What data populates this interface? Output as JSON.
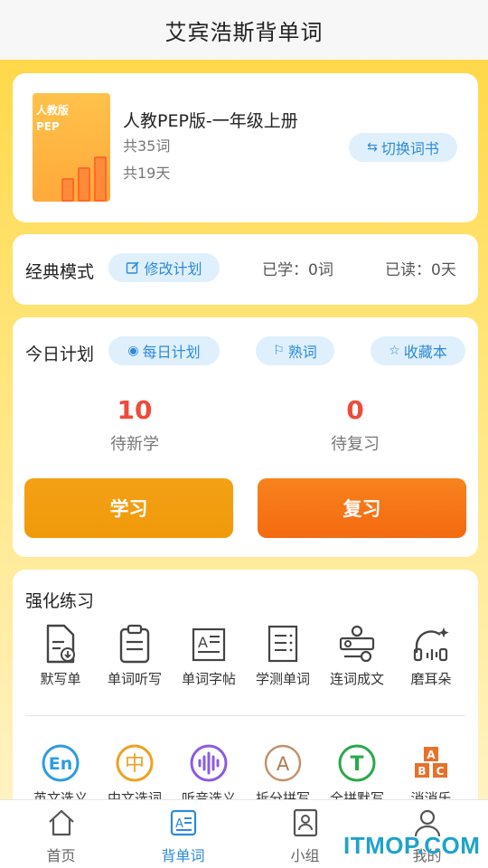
{
  "header": {
    "title": "艾宾浩斯背单词"
  },
  "book": {
    "cover_line1": "人教版",
    "cover_line2": "PEP",
    "title": "人教PEP版-一年级上册",
    "word_count": "共35词",
    "day_count": "共19天",
    "switch_label": "切换词书",
    "switch_icon": "swap-icon"
  },
  "mode": {
    "label": "经典模式",
    "edit_label": "修改计划",
    "learned": "已学：0词",
    "read": "已读：0天"
  },
  "plan": {
    "label": "今日计划",
    "daily_label": "每日计划",
    "familiar_label": "熟词",
    "favorites_label": "收藏本",
    "new_count": "10",
    "new_label": "待新学",
    "review_count": "0",
    "review_label": "待复习",
    "study_button": "学习",
    "review_button": "复习"
  },
  "practice": {
    "label": "强化练习",
    "row1": [
      {
        "label": "默写单",
        "icon": "document-download-icon"
      },
      {
        "label": "单词听写",
        "icon": "clipboard-icon"
      },
      {
        "label": "单词字帖",
        "icon": "copybook-icon"
      },
      {
        "label": "学测单词",
        "icon": "test-paper-icon"
      },
      {
        "label": "连词成文",
        "icon": "connect-words-icon"
      },
      {
        "label": "磨耳朵",
        "icon": "headphones-icon"
      }
    ],
    "row2": [
      {
        "label": "英文选义",
        "glyph": "En",
        "color": "#2d9ce0"
      },
      {
        "label": "中文选词",
        "glyph": "中",
        "color": "#f0a020"
      },
      {
        "label": "听音选义",
        "glyph": "",
        "color": "#8a5ce0"
      },
      {
        "label": "拆分拼写",
        "glyph": "A",
        "color": "#c0906a"
      },
      {
        "label": "全拼默写",
        "glyph": "T",
        "color": "#2aa84a"
      },
      {
        "label": "消消乐",
        "glyph": "ABC",
        "color": "#e8702a"
      }
    ]
  },
  "nav": {
    "items": [
      {
        "label": "首页",
        "icon": "home-icon"
      },
      {
        "label": "背单词",
        "icon": "word-book-icon"
      },
      {
        "label": "小组",
        "icon": "group-card-icon"
      },
      {
        "label": "我的",
        "icon": "profile-icon"
      }
    ],
    "active_index": 1
  },
  "watermark": "ITMOP.COM",
  "colors": {
    "accent_blue": "#2d8ad8",
    "accent_red": "#ef4a3a",
    "study_orange": "#f09a0a",
    "review_orange": "#f46a10",
    "background_yellow": "#ffd84a"
  }
}
